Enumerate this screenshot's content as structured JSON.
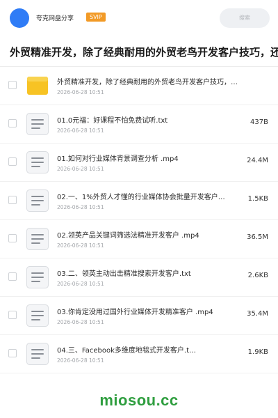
{
  "header": {
    "brand": "夸克网盘分享",
    "badge": "SVIP",
    "search_placeholder": "搜索"
  },
  "share": {
    "title": "外贸精准开发，除了经典耐用的外贸老鸟开发客户技巧，还"
  },
  "files": [
    {
      "type": "folder",
      "name": "外贸精准开发，除了经典耐用的外贸老鸟开发客户技巧，…",
      "date": "2026-06-28 10:51",
      "size": ""
    },
    {
      "type": "file",
      "name": "01.0元福：好课程不怕免费试听.txt",
      "date": "2026-06-28 10:51",
      "size": "437B"
    },
    {
      "type": "file",
      "name": "01.如何对行业媒体背景调查分析 .mp4",
      "date": "2026-06-28 10:51",
      "size": "24.4M"
    },
    {
      "type": "file",
      "name": "02.一、1%外贸人才懂的行业媒体协会批量开发客户…",
      "date": "2026-06-28 10:51",
      "size": "1.5KB"
    },
    {
      "type": "file",
      "name": "02.领英产品关键词筛选法精准开发客户 .mp4",
      "date": "2026-06-28 10:51",
      "size": "36.5M"
    },
    {
      "type": "file",
      "name": "03.二、领英主动出击精准搜索开发客户.txt",
      "date": "2026-06-28 10:51",
      "size": "2.6KB"
    },
    {
      "type": "file",
      "name": "03.你肯定没用过国外行业媒体开发精准客户 .mp4",
      "date": "2026-06-28 10:51",
      "size": "35.4M"
    },
    {
      "type": "file",
      "name": "04.三、Facebook多维度地毯式开发客户.t…",
      "date": "2026-06-28 10:51",
      "size": "1.9KB"
    }
  ],
  "watermark": "miosou.cc",
  "colors": {
    "accent": "#2f7cf6",
    "svip": "#f29a26",
    "folder": "#f7c324",
    "watermark": "#2f9e3f"
  }
}
